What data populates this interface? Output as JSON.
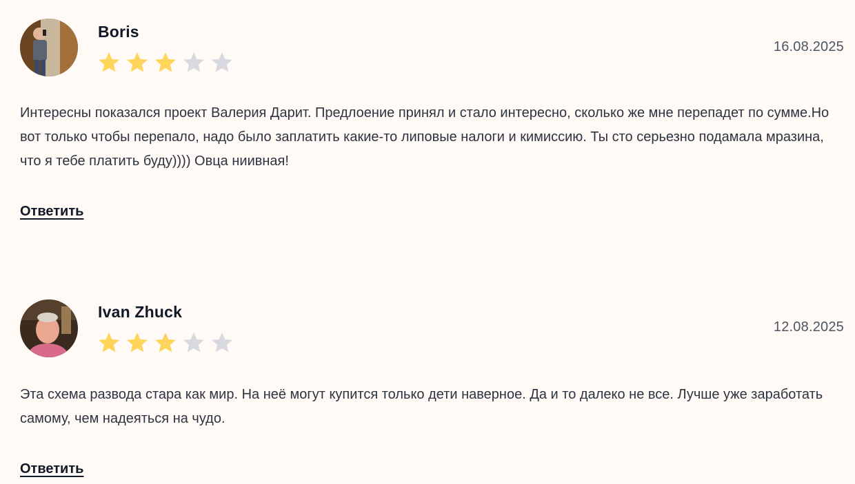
{
  "colors": {
    "star_filled": "#ffd45a",
    "star_empty": "#d7d9de",
    "background": "#fffaf6"
  },
  "reply_label": "Ответить",
  "reviews": [
    {
      "author": "Boris",
      "date": "16.08.2025",
      "rating": 3,
      "max_rating": 5,
      "avatar": "user-photo-icon",
      "text": "Интересны показался проект Валерия Дарит. Предлоение принял и стало интересно, сколько же мне перепадет по сумме.Но вот только чтобы перепало, надо было заплатить какие-то липовые налоги и кимиссию. Ты сто серьезно подамала мразина, что я тебе платить буду)))) Овца ниивная!"
    },
    {
      "author": "Ivan Zhuck",
      "date": "12.08.2025",
      "rating": 3,
      "max_rating": 5,
      "avatar": "user-photo-icon",
      "text": "Эта схема развода стара как мир. На неё могут купится только дети наверное. Да и то далеко не все. Лучше уже заработать самому, чем надеяться на чудо."
    }
  ]
}
